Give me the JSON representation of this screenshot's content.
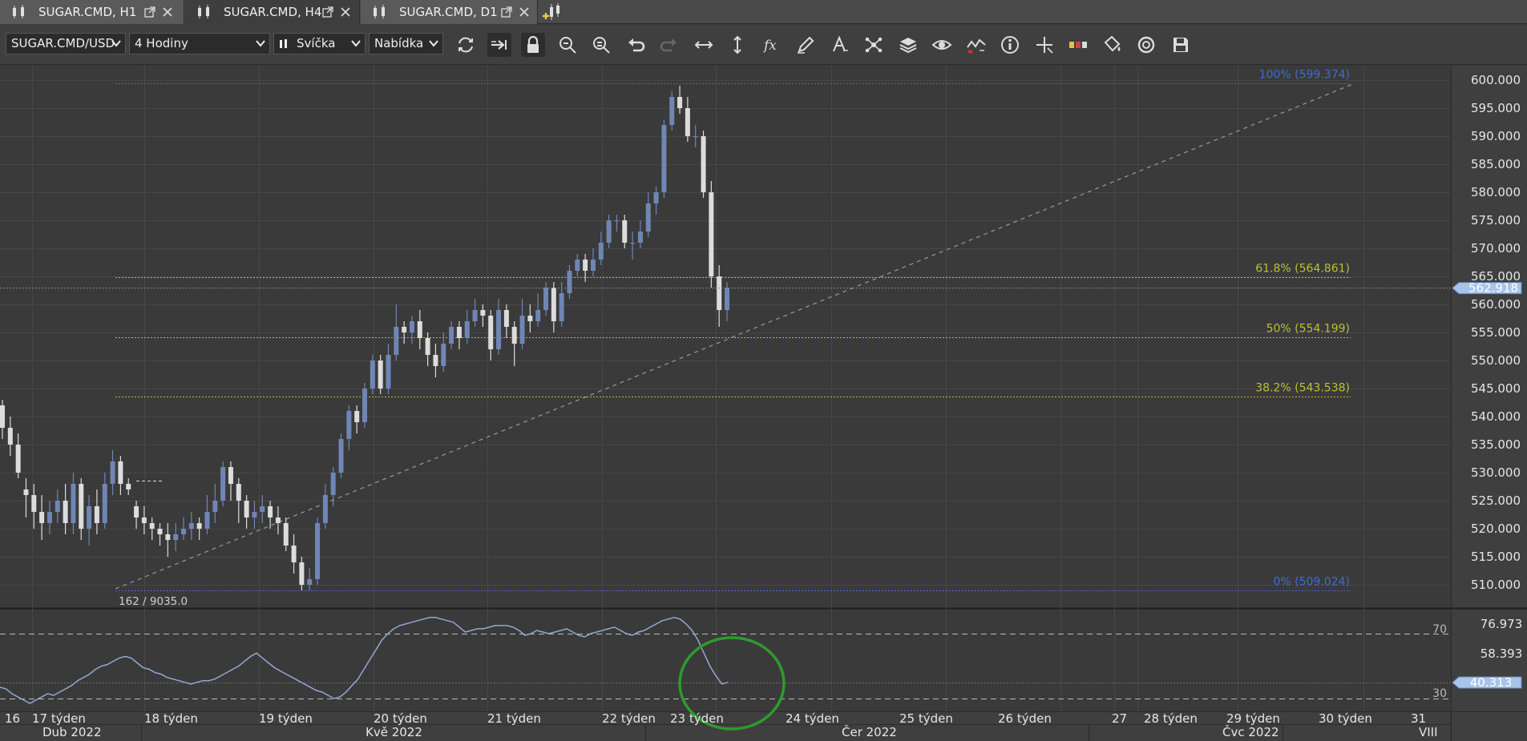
{
  "tabs": [
    {
      "label": "SUGAR.CMD, H1",
      "active": false
    },
    {
      "label": "SUGAR.CMD, H4",
      "active": true
    },
    {
      "label": "SUGAR.CMD, D1",
      "active": false
    }
  ],
  "toolbar": {
    "instrument": "SUGAR.CMD/USD",
    "period": "4 Hodiny",
    "chart_type": "Svíčka",
    "price_side": "Nabídka",
    "buttons": [
      "refresh-icon",
      "shift-chart-icon",
      "lock-icon",
      "zoom-in-icon",
      "zoom-out-icon",
      "undo-icon",
      "redo-icon",
      "horizontal-scale-icon",
      "vertical-scale-icon",
      "indicators-fx-icon",
      "pencil-draw-icon",
      "text-tool-icon",
      "network-icon",
      "layers-icon",
      "eye-icon",
      "signal-chart-icon",
      "info-icon",
      "crosshair-icon",
      "color-bars-icon",
      "paint-bucket-icon",
      "camera-shutter-icon",
      "save-icon"
    ]
  },
  "colors": {
    "bull": "#6f86b5",
    "bear": "#dcdcdc",
    "fib0": "#3f6cd0",
    "fib_mid": "#b9c231",
    "price_tag": "#a8c4ea",
    "circle": "#2e9a2e",
    "osc": "#93a9d2"
  },
  "chart_data": {
    "type": "candlestick",
    "instrument": "SUGAR.CMD/USD",
    "timeframe": "H4",
    "ylim": [
      507,
      602
    ],
    "yticks": [
      "510.000",
      "515.000",
      "520.000",
      "525.000",
      "530.000",
      "535.000",
      "540.000",
      "545.000",
      "550.000",
      "555.000",
      "560.000",
      "565.000",
      "570.000",
      "575.000",
      "580.000",
      "585.000",
      "590.000",
      "595.000",
      "600.000"
    ],
    "current_price": "562.918",
    "info_label": "162 / 9035.0",
    "fib_levels": [
      {
        "label": "100% (599.374)",
        "value": 599.374
      },
      {
        "label": "61.8% (564.861)",
        "value": 564.861
      },
      {
        "label": "50% (554.199)",
        "value": 554.199
      },
      {
        "label": "38.2% (543.538)",
        "value": 543.538
      },
      {
        "label": "0% (509.024)",
        "value": 509.024
      }
    ],
    "candles": [
      [
        542,
        538,
        543,
        536
      ],
      [
        538,
        535,
        540,
        533
      ],
      [
        535,
        530,
        537,
        529
      ],
      [
        527,
        526,
        529,
        522
      ],
      [
        526,
        523,
        528,
        520
      ],
      [
        523,
        521,
        526,
        518
      ],
      [
        521,
        523,
        525,
        519
      ],
      [
        523,
        525,
        527,
        521
      ],
      [
        525,
        521,
        528,
        519
      ],
      [
        521,
        528,
        530,
        519
      ],
      [
        528,
        520,
        529,
        518
      ],
      [
        520,
        524,
        526,
        517
      ],
      [
        524,
        521,
        527,
        519
      ],
      [
        521,
        528,
        530,
        520
      ],
      [
        528,
        532,
        534,
        526
      ],
      [
        532,
        528,
        533,
        526
      ],
      [
        528,
        527,
        529,
        526
      ],
      [
        524,
        522,
        525,
        520
      ],
      [
        522,
        521,
        524,
        519
      ],
      [
        521,
        520,
        522,
        518
      ],
      [
        520,
        519,
        521,
        517
      ],
      [
        519,
        518,
        521,
        515
      ],
      [
        518,
        519,
        521,
        516
      ],
      [
        519,
        520,
        522,
        518
      ],
      [
        520,
        521,
        523,
        518
      ],
      [
        521,
        520,
        522,
        518
      ],
      [
        520,
        523,
        526,
        519
      ],
      [
        523,
        525,
        528,
        521
      ],
      [
        525,
        531,
        532,
        524
      ],
      [
        531,
        528,
        532,
        525
      ],
      [
        528,
        525,
        529,
        521
      ],
      [
        525,
        522,
        526,
        520
      ],
      [
        522,
        523,
        525,
        520
      ],
      [
        523,
        524,
        526,
        521
      ],
      [
        524,
        522,
        525,
        520
      ],
      [
        522,
        521,
        524,
        519
      ],
      [
        521,
        517,
        522,
        516
      ],
      [
        517,
        514,
        519,
        512
      ],
      [
        514,
        510,
        515,
        509
      ],
      [
        510,
        511,
        513,
        509
      ],
      [
        511,
        521,
        522,
        510
      ],
      [
        521,
        526,
        528,
        520
      ],
      [
        526,
        530,
        531,
        524
      ],
      [
        530,
        536,
        537,
        529
      ],
      [
        536,
        541,
        542,
        534
      ],
      [
        541,
        539,
        542,
        537
      ],
      [
        539,
        545,
        546,
        538
      ],
      [
        545,
        550,
        551,
        544
      ],
      [
        550,
        545,
        551,
        544
      ],
      [
        545,
        551,
        553,
        544
      ],
      [
        551,
        556,
        560,
        550
      ],
      [
        556,
        555,
        557,
        553
      ],
      [
        555,
        557,
        558,
        553
      ],
      [
        557,
        554,
        559,
        552
      ],
      [
        554,
        551,
        555,
        549
      ],
      [
        551,
        549,
        553,
        547
      ],
      [
        549,
        553,
        555,
        548
      ],
      [
        553,
        556,
        557,
        552
      ],
      [
        556,
        554,
        557,
        552
      ],
      [
        554,
        557,
        559,
        553
      ],
      [
        557,
        559,
        561,
        556
      ],
      [
        559,
        558,
        560,
        556
      ],
      [
        558,
        552,
        559,
        550
      ],
      [
        552,
        559,
        561,
        551
      ],
      [
        559,
        556,
        560,
        554
      ],
      [
        556,
        553,
        557,
        549
      ],
      [
        553,
        558,
        561,
        552
      ],
      [
        558,
        557,
        560,
        555
      ],
      [
        557,
        559,
        562,
        556
      ],
      [
        559,
        563,
        564,
        558
      ],
      [
        563,
        557,
        564,
        555
      ],
      [
        557,
        562,
        564,
        556
      ],
      [
        562,
        566,
        567,
        561
      ],
      [
        566,
        568,
        569,
        565
      ],
      [
        568,
        566,
        569,
        564
      ],
      [
        566,
        568,
        570,
        565
      ],
      [
        568,
        571,
        573,
        567
      ],
      [
        571,
        575,
        576,
        570
      ],
      [
        575,
        575,
        576,
        573
      ],
      [
        575,
        571,
        576,
        570
      ],
      [
        571,
        571,
        573,
        568
      ],
      [
        571,
        573,
        575,
        570
      ],
      [
        573,
        578,
        580,
        572
      ],
      [
        578,
        580,
        581,
        576
      ],
      [
        580,
        592,
        593,
        579
      ],
      [
        592,
        597,
        598,
        591
      ],
      [
        597,
        595,
        599,
        594
      ],
      [
        595,
        590,
        597,
        589
      ],
      [
        590,
        590,
        592,
        588
      ],
      [
        590,
        580,
        591,
        579
      ],
      [
        580,
        565,
        582,
        563
      ],
      [
        565,
        559,
        567,
        556
      ],
      [
        559,
        563,
        564,
        557
      ]
    ],
    "pending_line": {
      "value": 528.5
    },
    "oscillator": {
      "levels": [
        70,
        30
      ],
      "labels": {
        "level_70": "70",
        "level_30": "30",
        "top": "76.973",
        "mid": "58.393",
        "current": "40.313"
      },
      "ylim": [
        19,
        84
      ],
      "values": [
        37,
        36,
        33,
        31,
        29,
        27,
        29,
        31,
        33,
        32,
        34,
        36,
        38,
        41,
        43,
        45,
        48,
        50,
        51,
        53,
        55,
        56,
        55,
        52,
        49,
        48,
        46,
        45,
        43,
        42,
        41,
        40,
        39,
        40,
        41,
        41,
        42,
        44,
        46,
        48,
        50,
        53,
        56,
        58,
        55,
        52,
        49,
        47,
        45,
        43,
        41,
        39,
        37,
        35,
        34,
        32,
        30,
        31,
        34,
        38,
        42,
        48,
        54,
        60,
        66,
        70,
        73,
        75,
        76,
        77,
        78,
        79,
        80,
        80,
        79,
        78,
        77,
        74,
        71,
        72,
        73,
        73,
        74,
        75,
        75,
        75,
        74,
        72,
        69,
        70,
        72,
        71,
        70,
        71,
        72,
        73,
        71,
        69,
        68,
        70,
        71,
        72,
        73,
        74,
        72,
        70,
        69,
        71,
        72,
        74,
        76,
        78,
        79,
        80,
        79,
        76,
        72,
        66,
        58,
        50,
        44,
        39,
        40
      ]
    },
    "x_labels_week": [
      "16",
      "17 týden",
      "18 týden",
      "19 týden",
      "20 týden",
      "21 týden",
      "22 týden",
      "23 týden",
      "24 týden",
      "25 týden",
      "26 týden",
      "27",
      "28 týden",
      "29 týden",
      "30 týden",
      "31"
    ],
    "x_labels_month": [
      "Dub 2022",
      "Kvě 2022",
      "Čer 2022",
      "Čvc 2022",
      "VIII"
    ]
  }
}
